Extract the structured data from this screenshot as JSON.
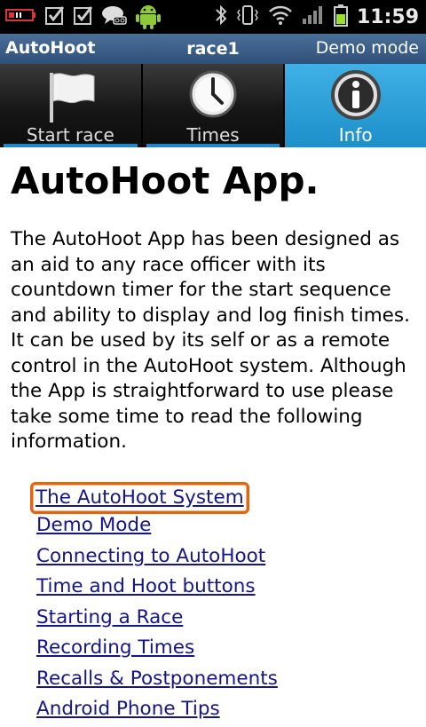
{
  "status_bar": {
    "time": "11:59",
    "left_icons": [
      "battery-warning-icon",
      "checkbox-icon",
      "checkbox-icon",
      "voicemail-icon",
      "android-icon"
    ],
    "right_icons": [
      "bluetooth-icon",
      "vibrate-icon",
      "wifi-icon",
      "signal-icon",
      "battery-icon"
    ]
  },
  "title_bar": {
    "app_name": "AutoHoot",
    "race_name": "race1",
    "mode": "Demo mode"
  },
  "tabs": [
    {
      "label": "Start race",
      "icon": "flag-icon",
      "active": false
    },
    {
      "label": "Times",
      "icon": "clock-icon",
      "active": false
    },
    {
      "label": "Info",
      "icon": "info-icon",
      "active": true
    }
  ],
  "content": {
    "heading": "AutoHoot App.",
    "paragraph": "The AutoHoot App has been designed as an aid to any race officer with its countdown timer for the start sequence and ability to display and log finish times. It can be used by its self or as a remote control in the AutoHoot system. Although the App is straightforward to use please take some time to read the following information.",
    "links": [
      "The AutoHoot System",
      "Demo Mode",
      "Connecting to AutoHoot",
      "Time and Hoot buttons",
      "Starting a Race",
      "Recording Times",
      "Recalls & Postponements",
      "Android Phone Tips"
    ]
  },
  "colors": {
    "accent": "#1d8fc9",
    "title_bar": "#3b5f8a",
    "link": "#14148c",
    "focus_ring": "#e4630e"
  }
}
